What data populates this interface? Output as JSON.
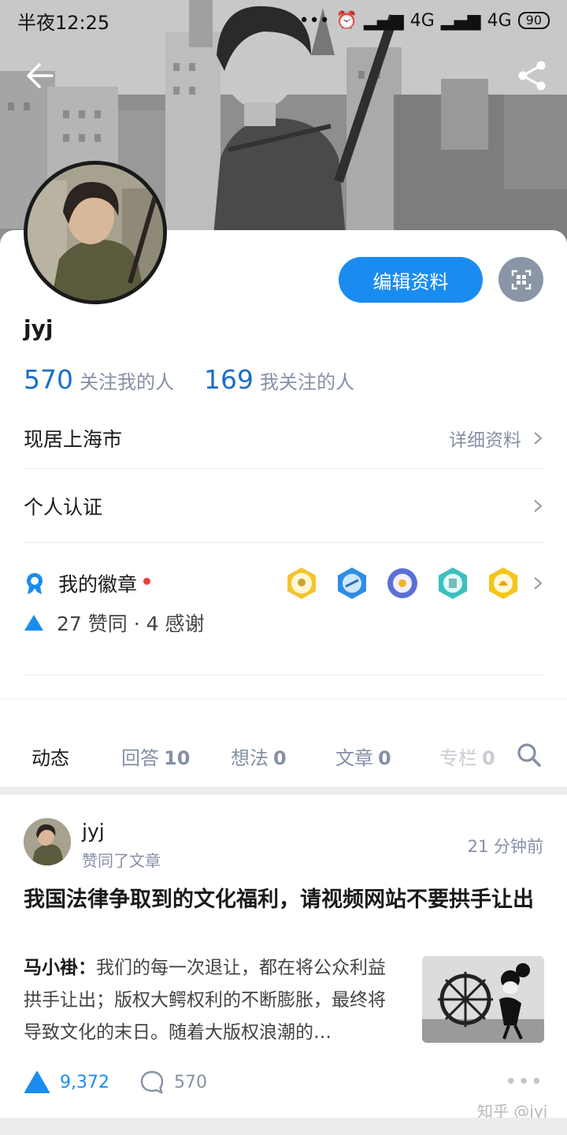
{
  "status_bar": {
    "time": "半夜12:25",
    "network_1": "4G",
    "network_2": "4G",
    "battery": "90"
  },
  "profile": {
    "username": "jyj",
    "followers_count": "570",
    "followers_label": "关注我的人",
    "following_count": "169",
    "following_label": "我关注的人",
    "edit_button": "编辑资料"
  },
  "info": {
    "location": "现居上海市",
    "details_link": "详细资料",
    "verification": "个人认证",
    "badges_label": "我的徽章",
    "badge_icons": [
      "badge-gold-icon",
      "badge-blue-icon",
      "badge-purple-icon",
      "badge-teal-icon",
      "badge-yellow-icon"
    ],
    "stats": "27 赞同 · 4 感谢"
  },
  "tabs": [
    {
      "label": "动态",
      "count": ""
    },
    {
      "label": "回答",
      "count": "10"
    },
    {
      "label": "想法",
      "count": "0"
    },
    {
      "label": "文章",
      "count": "0"
    },
    {
      "label": "专栏",
      "count": "0"
    }
  ],
  "feed": {
    "user": "jyj",
    "action": "赞同了文章",
    "time": "21 分钟前",
    "title": "我国法律争取到的文化福利，请视频网站不要拱手让出",
    "excerpt_author": "马小褂：",
    "excerpt_text": "我们的每一次退让，都在将公众利益拱手让出；版权大鳄权利的不断膨胀，最终将导致文化的末日。随着大版权浪潮的…",
    "votes": "9,372",
    "comments": "570",
    "watermark": "知乎 @jyj"
  },
  "colors": {
    "accent": "#1a8cf0",
    "count_blue": "#1a6fc8",
    "muted": "#8590a6",
    "red_dot": "#f1403c"
  }
}
